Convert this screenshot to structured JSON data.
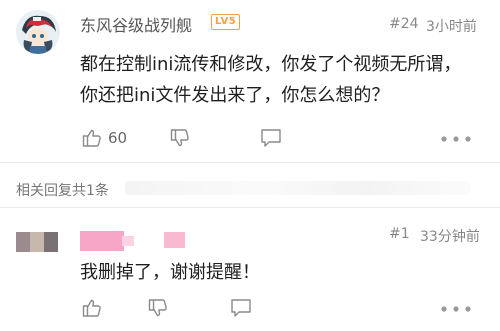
{
  "comment": {
    "username": "东风谷级战列舰",
    "level_badge": "LV5",
    "floor": "#24",
    "time": "3小时前",
    "text": "都在控制ini流传和修改，你发了个视频无所谓，\n你还把ini文件发出来了，你怎么想的？",
    "like_count": "60"
  },
  "replies_header": {
    "label": "相关回复共1条"
  },
  "reply": {
    "floor": "#1",
    "time": "33分钟前",
    "text": "我删掉了，谢谢提醒！"
  },
  "colors": {
    "level_badge": "#f2a14a",
    "text_primary": "#1f1f1f",
    "text_secondary": "#888888",
    "reply_name_redacted": "#f7a6c8"
  },
  "icons": {
    "like": "thumbs-up-icon",
    "dislike": "thumbs-down-icon",
    "reply": "reply-bubble-icon",
    "more": "more-dots-icon"
  }
}
